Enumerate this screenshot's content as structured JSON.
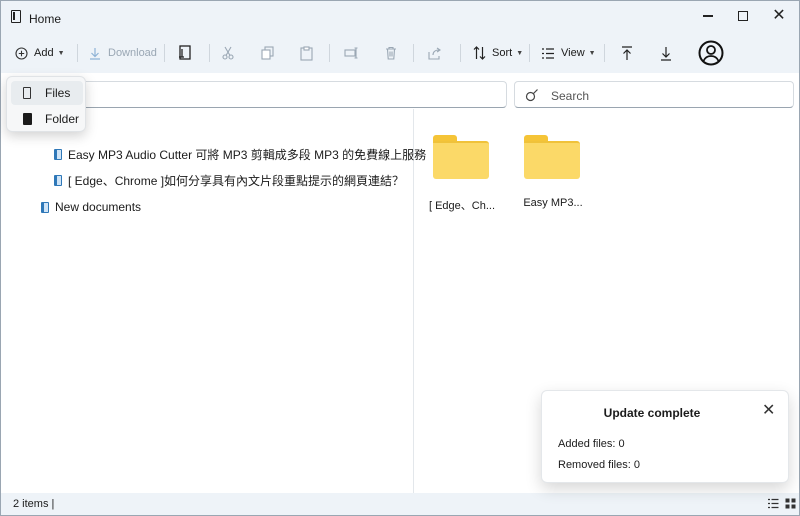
{
  "window": {
    "title": "Home"
  },
  "toolbar": {
    "add_label": "Add",
    "download_label": "Download",
    "sort_label": "Sort",
    "view_label": "View"
  },
  "add_menu": {
    "items": [
      "Files",
      "Folder"
    ]
  },
  "search": {
    "placeholder": "Search"
  },
  "tree": {
    "children": [
      "Easy MP3 Audio Cutter 可將 MP3 剪輯成多段 MP3 的免費線上服務",
      "[ Edge、Chrome ]如何分享具有內文片段重點提示的網頁連結？"
    ],
    "root_item": "New documents"
  },
  "folders": [
    "[ Edge、Ch...",
    "Easy MP3..."
  ],
  "status": {
    "items_text": "2 items |"
  },
  "toast": {
    "title": "Update complete",
    "added_label": "Added files:",
    "added_value": "0",
    "removed_label": "Removed files:",
    "removed_value": "0"
  },
  "colors": {
    "accent_icon": "#2f78b8",
    "folder": "#fbd968",
    "window_bg": "#eef3f8"
  }
}
